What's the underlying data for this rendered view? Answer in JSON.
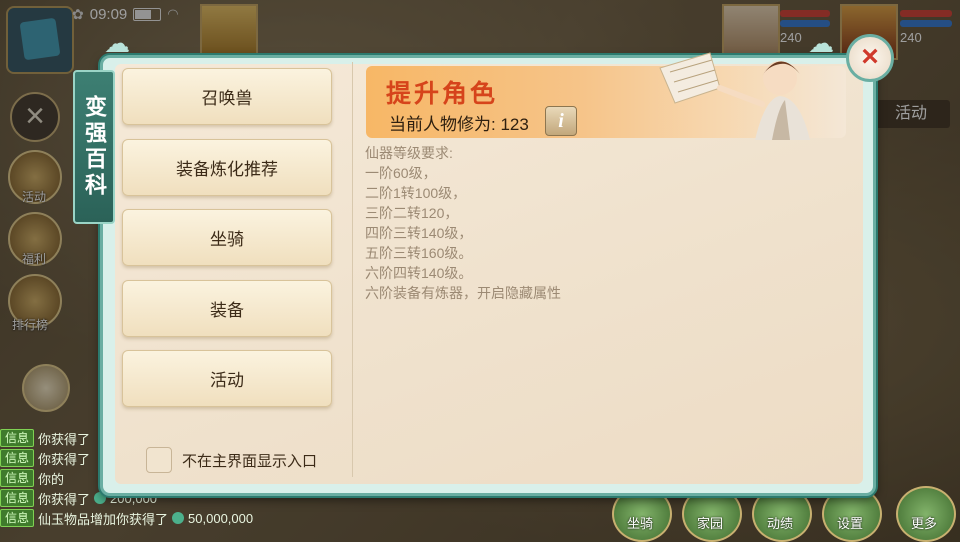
{
  "status_bar": {
    "time": "09:09"
  },
  "top_avatars": [
    {
      "level": "240"
    },
    {
      "level": "240"
    }
  ],
  "left_hud": {
    "labels": [
      "活动",
      "福利",
      "排行榜"
    ]
  },
  "chat": [
    {
      "tag": "信息",
      "text": "你获得了"
    },
    {
      "tag": "信息",
      "text": "你获得了"
    },
    {
      "tag": "信息",
      "text": "你的"
    },
    {
      "tag": "信息",
      "text": "你获得了",
      "amount": "200,000"
    },
    {
      "tag": "信息",
      "text": "仙玉物品增加你获得了",
      "amount": "50,000,000"
    }
  ],
  "bottom_buttons": [
    "坐骑",
    "家园",
    "动绩",
    "设置",
    "更多"
  ],
  "right_hud": {
    "activity_label": "活动"
  },
  "dialog": {
    "side_tab": "变强百科",
    "menu": [
      "召唤兽",
      "装备炼化推荐",
      "坐骑",
      "装备",
      "活动"
    ],
    "checkbox_label": "不在主界面显示入口",
    "banner": {
      "title": "提升角色",
      "sub_label": "当前人物修为:",
      "sub_value": "123"
    },
    "requirements_title": "仙器等级要求:",
    "requirements": [
      "一阶60级，",
      "二阶1转100级，",
      "三阶二转120，",
      "四阶三转140级，",
      "五阶三转160级。",
      "六阶四转140级。",
      "六阶装备有炼器，开启隐藏属性"
    ]
  }
}
